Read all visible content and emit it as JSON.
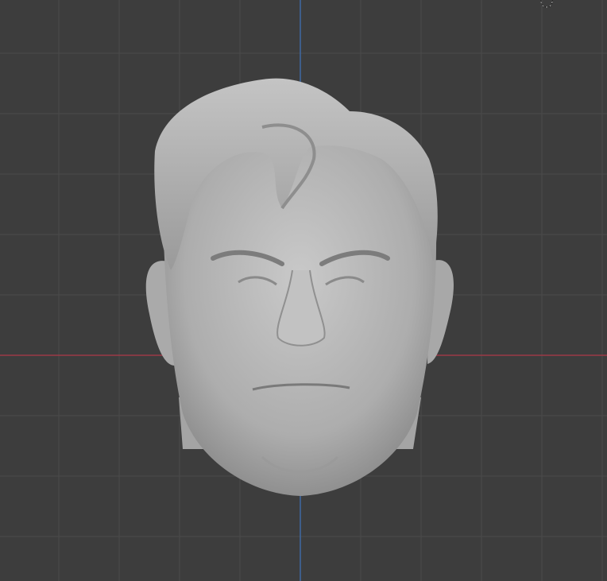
{
  "viewport": {
    "background_color": "#3d3d3d",
    "grid_color": "#4a4a4a",
    "x_axis_color": "#9b3a46",
    "y_axis_color": "#3f6aa3",
    "model_color": "#b4b4b4"
  },
  "icons": {
    "top_right": "3d-cursor-icon"
  }
}
